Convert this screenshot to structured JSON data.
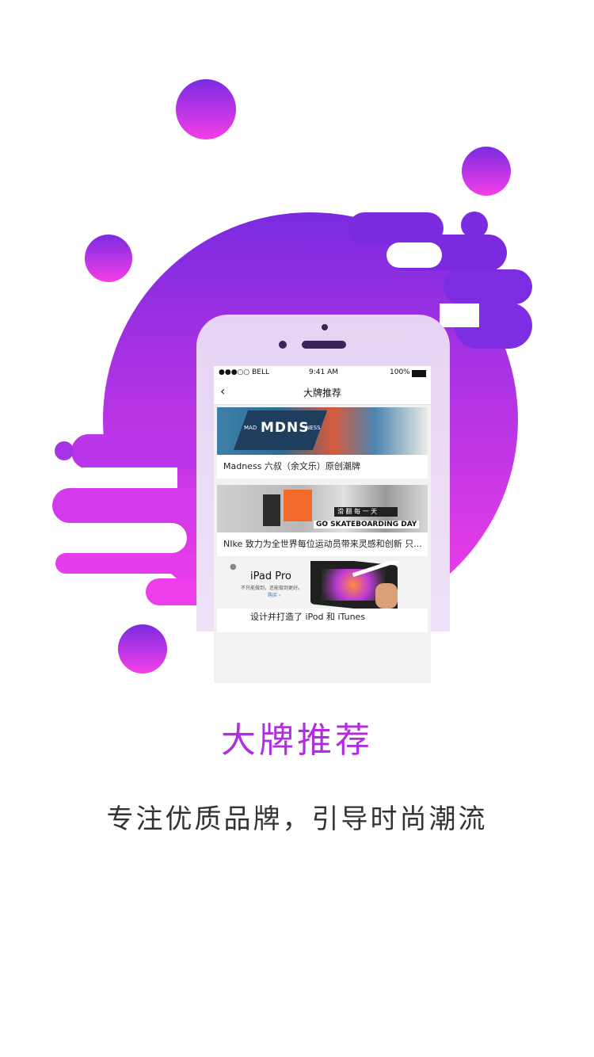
{
  "screen": {
    "status": {
      "carrier": "●●●○○ BELL",
      "time": "9:41 AM",
      "battery": "100%"
    },
    "nav": {
      "title": "大牌推荐",
      "back_icon": "chevron-left-icon"
    },
    "cards": [
      {
        "image_text": "MDNS",
        "image_sub_left": "MAD",
        "image_sub_right": "NESS",
        "caption": "Madness 六叔（余文乐）原创潮牌"
      },
      {
        "image_text": "GO SKATEBOARDING DAY",
        "image_sub": "滑 翻 每 一 天",
        "caption": "NIke 致力为全世界每位运动员带来灵感和创新 只..."
      },
      {
        "image_title": "iPad Pro",
        "image_sub": "不只能做到，还能做到更好。",
        "image_link": "购买 ›",
        "caption": "设计并打造了 iPod 和 iTunes"
      }
    ]
  },
  "heading": "大牌推荐",
  "subheading": "专注优质品牌，引导时尚潮流",
  "colors": {
    "purple": "#7b2ee0",
    "magenta": "#f43de8",
    "heading": "#b02de0"
  }
}
